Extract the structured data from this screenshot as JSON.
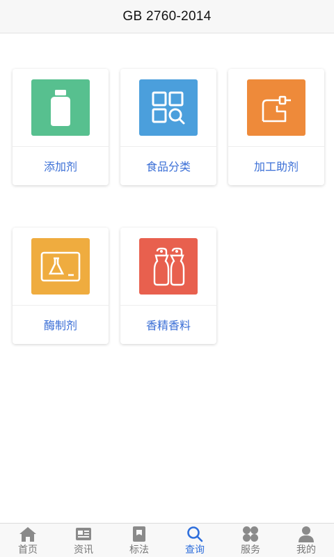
{
  "header": {
    "title": "GB 2760-2014"
  },
  "categories": [
    {
      "label": "添加剂",
      "icon": "bottle-icon",
      "color": "#57c08f"
    },
    {
      "label": "食品分类",
      "icon": "grid-search-icon",
      "color": "#4b9fdc"
    },
    {
      "label": "加工助剂",
      "icon": "pipe-icon",
      "color": "#ee8a3a"
    },
    {
      "label": "酶制剂",
      "icon": "flask-screen-icon",
      "color": "#efac3f"
    },
    {
      "label": "香精香料",
      "icon": "shakers-icon",
      "color": "#e8604e"
    }
  ],
  "tabbar": {
    "active_color": "#2f6fdc",
    "items": [
      {
        "label": "首页",
        "icon": "home-icon"
      },
      {
        "label": "资讯",
        "icon": "news-icon"
      },
      {
        "label": "标法",
        "icon": "book-icon"
      },
      {
        "label": "查询",
        "icon": "search-icon",
        "active": true
      },
      {
        "label": "服务",
        "icon": "clover-icon"
      },
      {
        "label": "我的",
        "icon": "user-icon"
      }
    ]
  }
}
